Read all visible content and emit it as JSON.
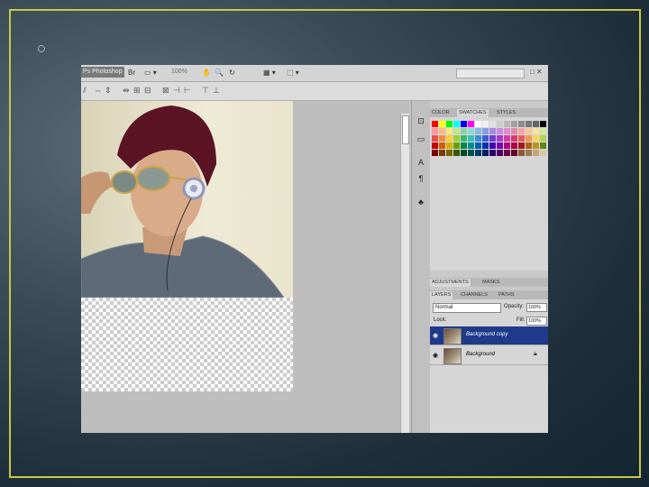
{
  "app": {
    "title": "Ps Photoshop",
    "zoom": "100%",
    "menu_icons": [
      "Br",
      "▭ ▾",
      "✋",
      "🔍",
      "↻",
      "▦ ▾",
      "⬚ ▾"
    ],
    "window_buttons": "□ ✕"
  },
  "options_bar": {
    "items": [
      "⫽",
      "⇔",
      "⇕",
      "⇹",
      "⊞",
      "⊟",
      "⊠",
      "⊣",
      "⊢",
      "⊤",
      "⊥"
    ]
  },
  "tools": {
    "items": [
      {
        "name": "color-picker-icon",
        "glyph": "⊡"
      },
      {
        "name": "navigator-icon",
        "glyph": "▭"
      },
      {
        "name": "character-icon",
        "glyph": "A"
      },
      {
        "name": "paragraph-icon",
        "glyph": "¶"
      },
      {
        "name": "clone-source-icon",
        "glyph": "♣"
      }
    ]
  },
  "color_panel": {
    "tabs": [
      "COLOR",
      "SWATCHES",
      "STYLES"
    ],
    "active_tab": "SWATCHES",
    "swatch_colors": [
      "#ff0000",
      "#ffff00",
      "#00ff00",
      "#00ffff",
      "#0000ff",
      "#ff00ff",
      "#ffffff",
      "#f0f0f0",
      "#e0e0e0",
      "#cccccc",
      "#b8b8b8",
      "#a0a0a0",
      "#8c8c8c",
      "#787878",
      "#646464",
      "#000000",
      "#f49a9a",
      "#f7b98b",
      "#fbe48a",
      "#c6e28a",
      "#8ad6a0",
      "#8ad7d7",
      "#8ab6e0",
      "#8a9ce0",
      "#a78ae0",
      "#c98ae0",
      "#e08ac9",
      "#e08aa7",
      "#f2a5a5",
      "#f5c7a0",
      "#f7e3a0",
      "#d3e7a0",
      "#ee4b4b",
      "#f28b3a",
      "#f7d13a",
      "#9fcf3a",
      "#3ab96e",
      "#3abcbc",
      "#3a8ed6",
      "#3a5ed6",
      "#6f3ad6",
      "#a63ad6",
      "#d63aa6",
      "#d63a6f",
      "#e85b5b",
      "#ef9a55",
      "#f4d755",
      "#b0d555",
      "#c40000",
      "#d45a00",
      "#d9ae00",
      "#6a9f00",
      "#00884a",
      "#008c8c",
      "#005fb0",
      "#0030b0",
      "#4200b0",
      "#7a00b0",
      "#b0007a",
      "#b00042",
      "#a61a1a",
      "#b3621a",
      "#b8961a",
      "#5f881a",
      "#7a0000",
      "#7a3a00",
      "#7a6400",
      "#3a5a00",
      "#004d2a",
      "#004f4f",
      "#003866",
      "#001c66",
      "#260066",
      "#460066",
      "#660046",
      "#660026",
      "#8a5a3a",
      "#a07a52",
      "#c4a57a",
      "#d8c7a5"
    ]
  },
  "adjustments_panel": {
    "tabs": [
      "ADJUSTMENTS",
      "MASKS"
    ]
  },
  "layers_panel": {
    "tabs": [
      "LAYERS",
      "CHANNELS",
      "PATHS"
    ],
    "blend_mode": "Normal",
    "opacity_label": "Opacity:",
    "opacity_value": "100%",
    "lock_label": "Lock:",
    "fill_label": "Fill:",
    "fill_value": "100%",
    "layers": [
      {
        "name": "Background copy",
        "selected": true,
        "locked": false
      },
      {
        "name": "Background",
        "selected": false,
        "locked": true
      }
    ]
  }
}
